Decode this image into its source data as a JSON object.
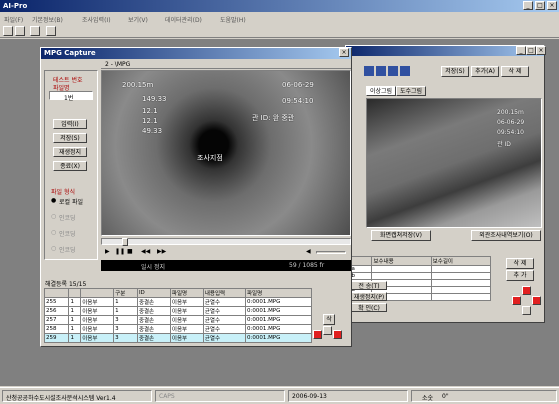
{
  "app": {
    "title": "AI-Pro"
  },
  "menu": [
    "파일(F)",
    "기본정보(B)",
    "조사입력(I)",
    "보기(V)",
    "데이터관리(D)",
    "도움말(H)"
  ],
  "capture": {
    "title": "MPG Capture",
    "file_tab": "2 - \\MPG",
    "overlay": {
      "distance": "200.15m",
      "l1": "149.33",
      "l2": "12.1",
      "l3": "12.1",
      "l4": "49.33",
      "date": "06-06-29",
      "time": "09:54:10",
      "line3": "관 ID: 완 중관",
      "center": "조사지점"
    },
    "left_panel": {
      "label_top": "테스트 번호",
      "label2": "파일명",
      "input_value": "1번",
      "buttons": [
        "입력(I)",
        "저장(S)",
        "재생정지",
        "종료(X)"
      ],
      "section_title": "파일 형식",
      "radios": [
        "로컬 파일",
        "인코딩",
        "인코딩",
        "인코딩"
      ]
    },
    "controls": {
      "status": "일시 정지",
      "counter": "59 / 1085 fr"
    },
    "list": {
      "title": "해결등록 15/15",
      "headers": [
        "",
        "",
        "",
        "구분",
        "ID",
        "파일명",
        "내용입력",
        "파일명"
      ],
      "rows": [
        [
          "255",
          "1",
          "이음부",
          "1",
          "중결손",
          "이음부",
          "균열수",
          "0:0001.MPG"
        ],
        [
          "256",
          "1",
          "이음부",
          "1",
          "중결손",
          "이음부",
          "균열수",
          "0:0001.MPG"
        ],
        [
          "257",
          "1",
          "이음부",
          "3",
          "중결손",
          "이음부",
          "균열수",
          "0:0001.MPG"
        ],
        [
          "258",
          "1",
          "이음부",
          "3",
          "중결손",
          "이음부",
          "균열수",
          "0:0001.MPG"
        ],
        [
          "259",
          "1",
          "이음부",
          "3",
          "중결손",
          "이음부",
          "균열수",
          "0:0001.MPG"
        ]
      ],
      "side_buttons": [
        "삭"
      ]
    }
  },
  "right_panel": {
    "top_buttons": [
      "저장(S)",
      "추가(A)",
      "삭 제"
    ],
    "tabs": [
      "이상그림",
      "도수그림"
    ],
    "bottom_buttons": [
      "화면캡쳐저장(V)",
      "외관조사내역보기(O)"
    ],
    "table_headers": [
      "",
      "보수내용",
      "보수길이"
    ],
    "table_rows": [
      "1a",
      "1b",
      "1c",
      "2a",
      "2b"
    ],
    "action_buttons": [
      "전 송(T)",
      "재생정지(P)",
      "확 인(C)"
    ],
    "side_buttons": [
      "삭 제",
      "추 가"
    ],
    "overlay": {
      "v1": "200.15m",
      "v2": "06-06-29",
      "v3": "09:54:10",
      "v4": "관 ID"
    }
  },
  "statusbar": {
    "left": "산청공공하수도시설조사분석시스템 Ver1.4",
    "caps": "CAPS",
    "date": "2006-09-13",
    "zoom_label": "소숫",
    "zoom_value": "0\""
  }
}
